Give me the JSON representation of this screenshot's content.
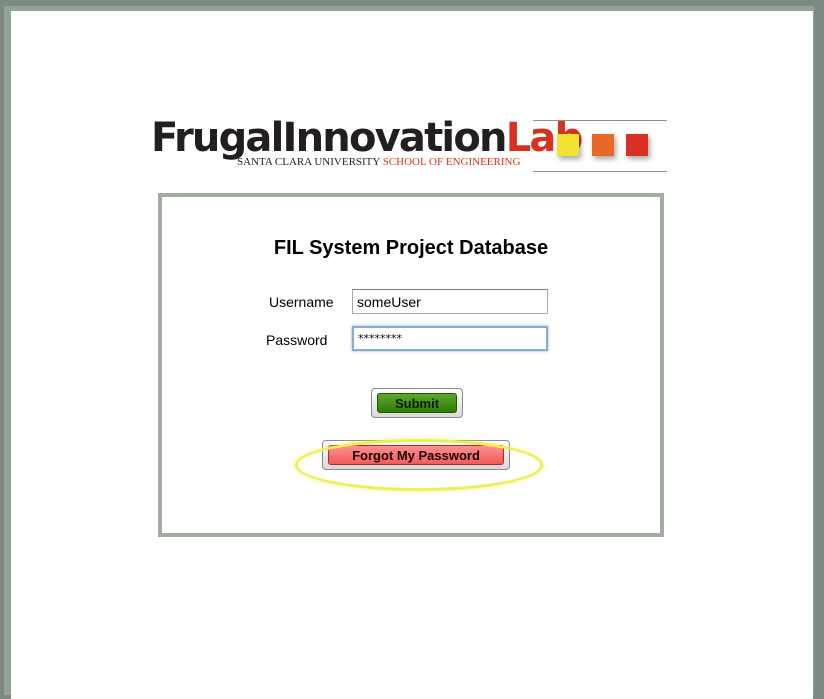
{
  "logo": {
    "word_dark": "FrugalInnovation",
    "word_red": "Lab",
    "sub_dark": "SANTA CLARA UNIVERSITY",
    "sub_red": "SCHOOL OF ENGINEERING"
  },
  "brand_colors": {
    "yellow": "#f2e232",
    "orange": "#e8682a",
    "red": "#d92f26"
  },
  "login": {
    "title": "FIL System Project Database",
    "username_label": "Username",
    "username_value": "someUser",
    "password_label": "Password",
    "password_value": "********",
    "submit_label": "Submit",
    "forgot_label": "Forgot My Password"
  }
}
